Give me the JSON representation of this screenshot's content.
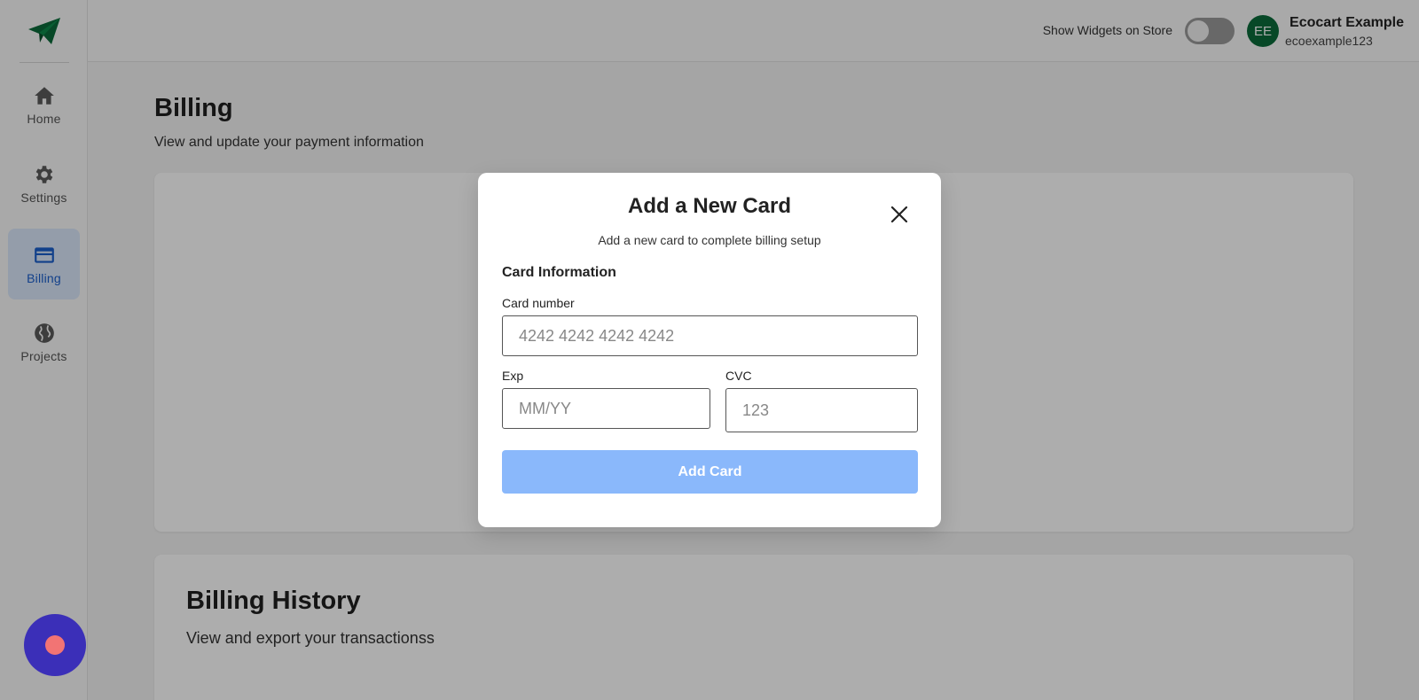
{
  "sidebar": {
    "items": [
      {
        "label": "Home",
        "icon": "home-icon"
      },
      {
        "label": "Settings",
        "icon": "gear-icon"
      },
      {
        "label": "Billing",
        "icon": "credit-card-icon",
        "active": true
      },
      {
        "label": "Projects",
        "icon": "globe-icon"
      }
    ]
  },
  "header": {
    "widget_toggle_label": "Show Widgets on Store",
    "widget_toggle_on": false,
    "avatar_initials": "EE",
    "user_name": "Ecocart Example",
    "user_handle": "ecoexample123"
  },
  "main": {
    "title": "Billing",
    "subtitle": "View and update your payment information",
    "history": {
      "title": "Billing History",
      "subtitle": "View and export your transactionss"
    }
  },
  "modal": {
    "title": "Add a New Card",
    "subtitle": "Add a new card to complete billing setup",
    "section_heading": "Card Information",
    "card_number": {
      "label": "Card number",
      "placeholder": "4242 4242 4242 4242",
      "value": ""
    },
    "exp": {
      "label": "Exp",
      "placeholder": "MM/YY",
      "value": ""
    },
    "cvc": {
      "label": "CVC",
      "placeholder": "123",
      "value": ""
    },
    "submit_label": "Add Card",
    "submit_disabled": true
  },
  "colors": {
    "brand_green": "#0b6b3a",
    "active_blue": "#1a5fcc",
    "button_disabled_blue": "#8ab8fb",
    "help_fab": "#3b2fb8",
    "help_dot": "#f27474"
  }
}
